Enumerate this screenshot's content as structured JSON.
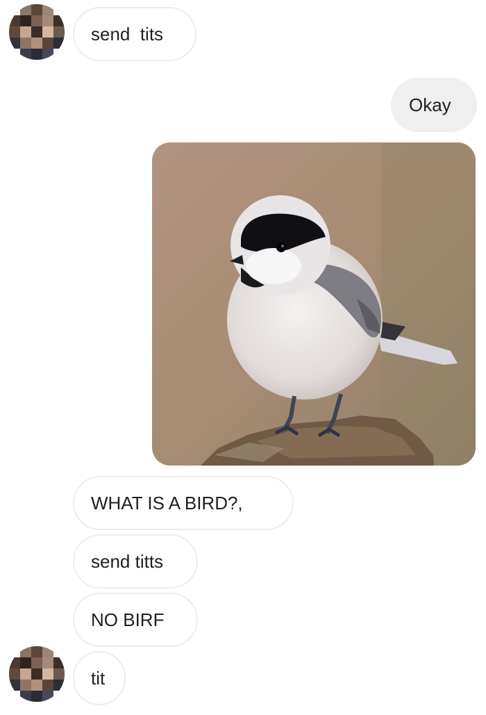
{
  "conversation": {
    "messages": [
      {
        "sender": "contact",
        "text": "send  tits"
      },
      {
        "sender": "me",
        "text": "Okay"
      },
      {
        "sender": "me",
        "type": "photo",
        "depicts": "chickadee-bird-photo"
      },
      {
        "sender": "contact",
        "text": "WHAT IS A BIRD?,"
      },
      {
        "sender": "contact",
        "text": "send titts"
      },
      {
        "sender": "contact",
        "text": "NO BIRF"
      },
      {
        "sender": "contact",
        "text": "tit"
      }
    ]
  },
  "icons": {
    "contact_avatar": "pixelated-avatar-icon"
  },
  "colors": {
    "incoming_bubble_bg": "#ffffff",
    "incoming_bubble_border": "#ececec",
    "outgoing_bubble_bg": "#efefef",
    "text": "#1f1f1f"
  }
}
